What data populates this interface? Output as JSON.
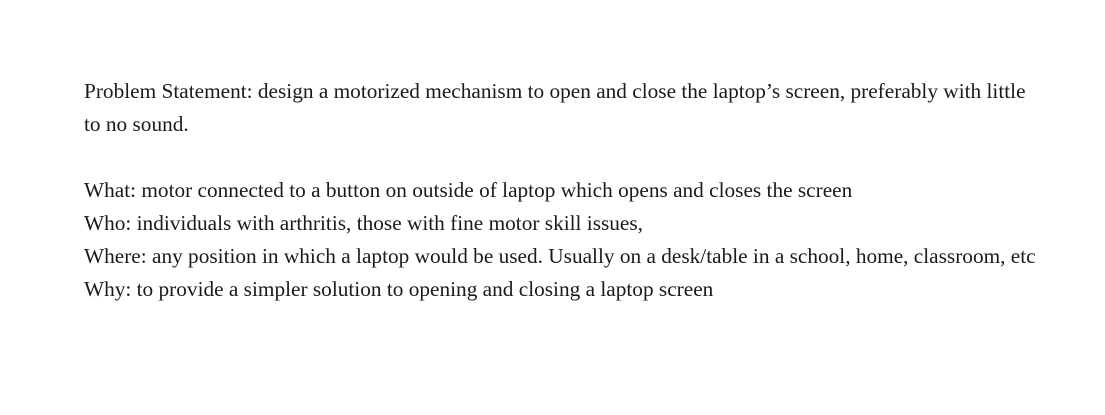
{
  "document": {
    "problem_statement": "Problem Statement: design a motorized mechanism to open and close the laptop’s screen, preferably with little to no sound.",
    "what": "What: motor connected to a button on outside of laptop which opens and closes the screen",
    "who": "Who: individuals with arthritis, those with fine motor skill issues,",
    "where": "Where: any position in which a laptop would be used. Usually on a desk/table in a school, home, classroom, etc",
    "why": "Why: to provide a simpler solution to opening and closing a laptop screen"
  }
}
